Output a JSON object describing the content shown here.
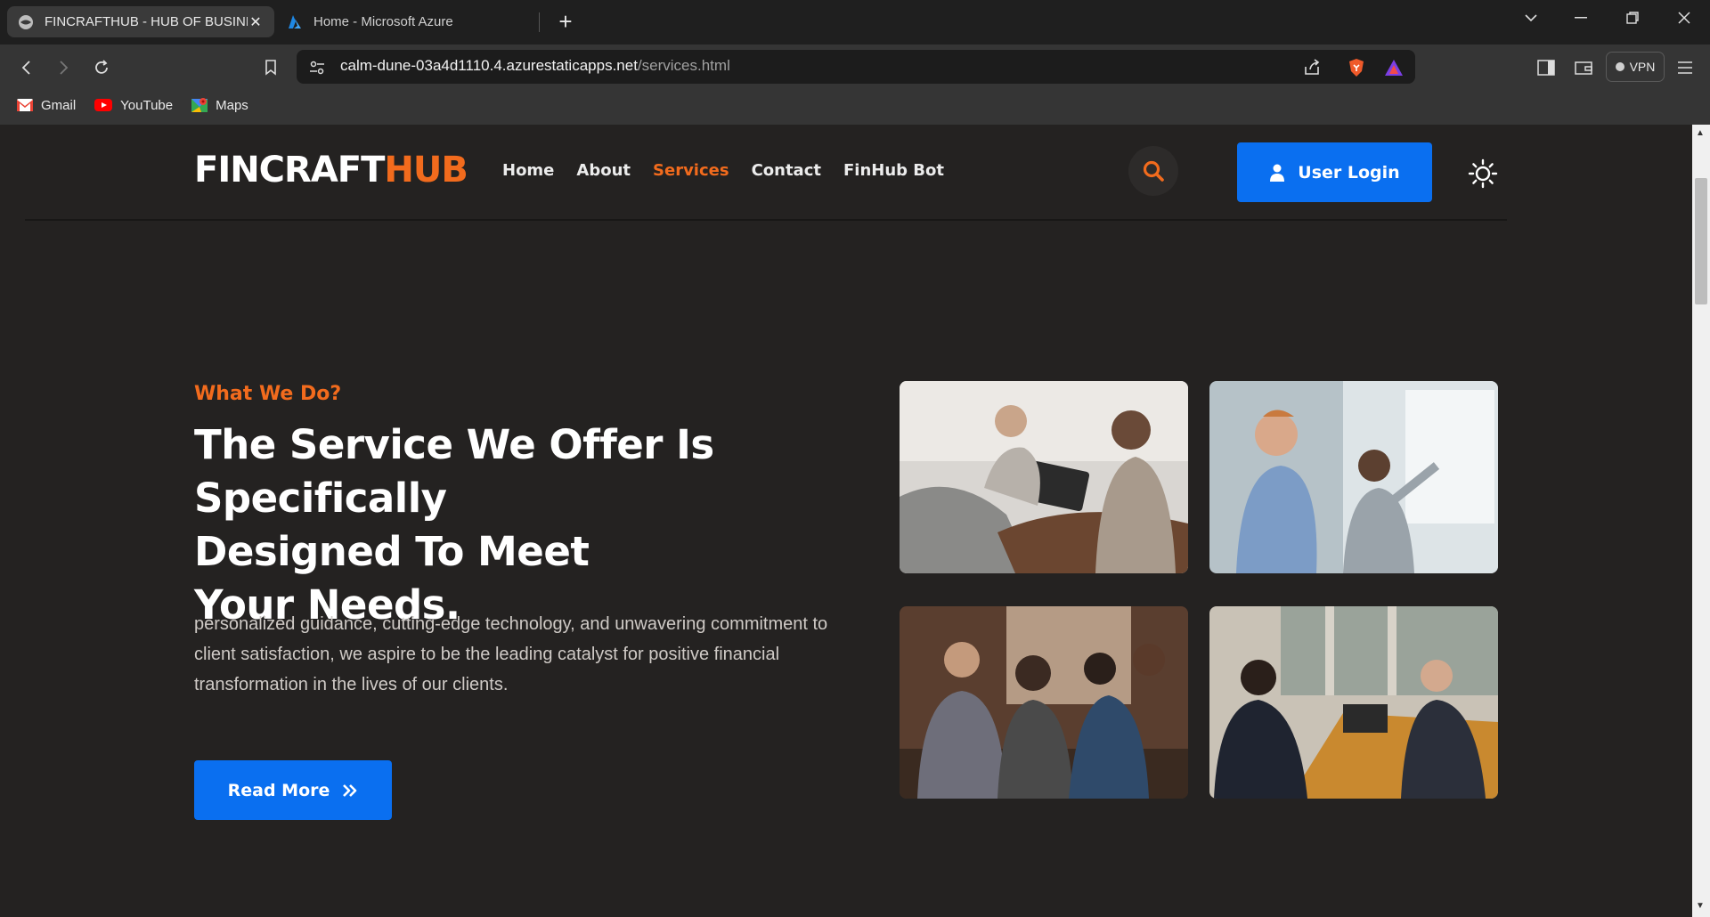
{
  "browser": {
    "tabs": [
      {
        "title": "FINCRAFTHUB - HUB OF BUSINE",
        "active": true
      },
      {
        "title": "Home - Microsoft Azure",
        "active": false
      }
    ],
    "url": {
      "host": "calm-dune-03a4d1110.4.azurestaticapps.net",
      "path": "/services.html"
    },
    "vpn_label": "VPN",
    "bookmarks": [
      {
        "label": "Gmail",
        "icon": "gmail-icon"
      },
      {
        "label": "YouTube",
        "icon": "youtube-icon"
      },
      {
        "label": "Maps",
        "icon": "maps-icon"
      }
    ]
  },
  "site": {
    "logo": {
      "part1": "FINCRAFT",
      "part2": "HUB"
    },
    "nav": [
      {
        "label": "Home"
      },
      {
        "label": "About"
      },
      {
        "label": "Services",
        "current": true
      },
      {
        "label": "Contact"
      },
      {
        "label": "FinHub Bot"
      }
    ],
    "login_label": "User Login",
    "accent_color": "#f26b1d",
    "button_color": "#0a6ff0"
  },
  "hero": {
    "eyebrow": "What We Do?",
    "headline_line1": "The Service We Offer Is Specifically",
    "headline_line2": "Designed To Meet",
    "headline_strong": "Your Needs.",
    "description": "personalized guidance, cutting-edge technology, and unwavering commitment to client satisfaction, we aspire to be the leading catalyst for positive financial transformation in the lives of our clients.",
    "button_label": "Read More"
  }
}
